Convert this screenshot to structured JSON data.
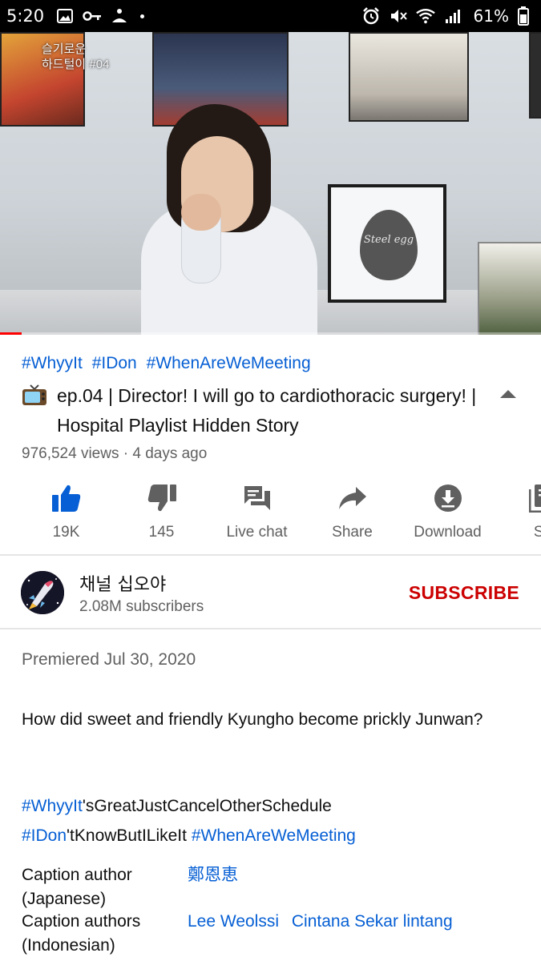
{
  "status_bar": {
    "time": "5:20",
    "battery": "61%"
  },
  "video": {
    "overlay_text_line1": "슬기로운",
    "overlay_text_line2": "하드털이 #04",
    "egg_text": "Steel egg",
    "progress": 0.04
  },
  "info": {
    "hashtags": [
      "#WhyyIt",
      "#IDon",
      "#WhenAreWeMeeting"
    ],
    "title": "ep.04 | Director! I will go to cardiothoracic surgery! | Hospital Playlist Hidden Story",
    "meta": "976,524 views · 4 days ago"
  },
  "actions": [
    {
      "label": "19K",
      "icon": "thumbs-up-icon"
    },
    {
      "label": "145",
      "icon": "thumbs-down-icon"
    },
    {
      "label": "Live chat",
      "icon": "live-chat-icon"
    },
    {
      "label": "Share",
      "icon": "share-icon"
    },
    {
      "label": "Download",
      "icon": "download-icon"
    },
    {
      "label": "Sa",
      "icon": "save-icon"
    }
  ],
  "channel": {
    "name": "채널 십오야",
    "subscribers": "2.08M subscribers",
    "subscribe_label": "SUBSCRIBE"
  },
  "description": {
    "premiered": "Premiered Jul 30, 2020",
    "body": "How did sweet and friendly Kyungho become prickly Junwan?",
    "tags_line1": {
      "tag": "#WhyyIt",
      "rest": "'sGreatJustCancelOtherSchedule"
    },
    "tags_line2": {
      "tag1": "#IDon",
      "rest": "'tKnowButILikeIt ",
      "tag2": "#WhenAreWeMeeting"
    },
    "captions": [
      {
        "label": "Caption author (Japanese)",
        "values": [
          "鄭恩恵"
        ]
      },
      {
        "label": "Caption authors (Indonesian)",
        "values": [
          "Lee Weolssi",
          "Cintana Sekar lintang"
        ]
      }
    ]
  },
  "colors": {
    "link": "#065fd4",
    "subscribe": "#cc0000",
    "action_blue": "#065fd4",
    "icon_gray": "#606060"
  }
}
